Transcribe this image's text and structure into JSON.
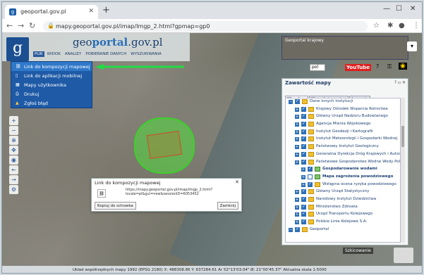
{
  "browser": {
    "tab_title": "geoportal.gov.pl",
    "url": "mapy.geoportal.gov.pl/imap/Imgp_2.html?gpmap=gp0"
  },
  "header": {
    "brand_prefix": "geo",
    "brand_main": "portal",
    "brand_suffix": ".gov.pl",
    "menu": [
      "PLIK",
      "WIDOK",
      "ANALIZY",
      "POBIERANIE DANYCH",
      "WYSZUKIWANIA"
    ],
    "active_menu": "PLIK"
  },
  "dropdown": {
    "items": [
      {
        "label": "Link do kompozycji mapowej",
        "icon": "link-icon"
      },
      {
        "label": "Link do aplikacji mobilnej",
        "icon": "mobile-icon"
      },
      {
        "label": "Mapy użytkownika",
        "icon": "map-icon"
      },
      {
        "label": "Drukuj",
        "icon": "print-icon"
      },
      {
        "label": "Zgłoś błąd",
        "icon": "warning-icon"
      }
    ]
  },
  "popup": {
    "title": "Link do kompozycji mapowej",
    "link": "https://mapy.geoportal.gov.pl/imap/Imgp_2.html?locale=pl&gui=new&sessionID=6053452",
    "copy_label": "Kopiuj do schowka",
    "close_label": "Zamknij"
  },
  "minimap": {
    "label": "Geoportal krajowy"
  },
  "toolbar": {
    "lang": "pol",
    "youtube": "YouTube"
  },
  "panel": {
    "title": "Zawartość mapy",
    "tabs": [
      "Warstwy",
      "Wyszukaj warstwę",
      "Legenda"
    ],
    "active_tab": "Warstwy",
    "tree": [
      {
        "label": "Dane innych instytucji",
        "level": 0,
        "checked": true,
        "folder": true
      },
      {
        "label": "Krajowy Ośrodek Wsparcia Rolnictwa",
        "level": 1,
        "checked": true,
        "folder": true
      },
      {
        "label": "Główny Urząd Nadzoru Budowlanego",
        "level": 1,
        "checked": true,
        "folder": true
      },
      {
        "label": "Agencja Mienia Wojskowego",
        "level": 1,
        "checked": true,
        "folder": true
      },
      {
        "label": "Instytut Geodezji i Kartografii",
        "level": 1,
        "checked": true,
        "folder": true
      },
      {
        "label": "Instytut Meteorologii i Gospodarki Wodnej",
        "level": 1,
        "checked": true,
        "folder": true
      },
      {
        "label": "Państwowy Instytut Geologiczny",
        "level": 1,
        "checked": true,
        "folder": true
      },
      {
        "label": "Generalna Dyrekcja Dróg Krajowych i Autostr",
        "level": 1,
        "checked": true,
        "folder": true
      },
      {
        "label": "Państwowe Gospodarstwo Wodne Wody Pol",
        "level": 1,
        "checked": true,
        "folder": true
      },
      {
        "label": "Gospodarowanie wodami",
        "level": 2,
        "checked": true,
        "folder": false,
        "bold": true
      },
      {
        "label": "Mapa zagrożenia powodziowego",
        "level": 2,
        "checked": false,
        "folder": false,
        "bold": true
      },
      {
        "label": "Wstępna ocena ryzyka powodziowego",
        "level": 2,
        "checked": true,
        "folder": true
      },
      {
        "label": "Główny Urząd Statystyczny",
        "level": 1,
        "checked": true,
        "folder": true
      },
      {
        "label": "Narodowy Instytut Dziedzictwa",
        "level": 1,
        "checked": true,
        "folder": true
      },
      {
        "label": "Ministerstwo Zdrowia",
        "level": 1,
        "checked": true,
        "folder": true
      },
      {
        "label": "Urząd Transportu Kolejowego",
        "level": 1,
        "checked": true,
        "folder": true
      },
      {
        "label": "Polskie Linie Kolejowe S.A.",
        "level": 1,
        "checked": true,
        "folder": true
      },
      {
        "label": "Geoportal",
        "level": 0,
        "checked": true,
        "folder": true
      }
    ]
  },
  "sketch_label": "Szkicowanie",
  "status": "Układ współrzędnych mapy 1992 (EPSG 2180)   X: 488308.86 Y: 637284.61   Ar 52°13'03.04\" Ø: 21°00'45.37\"   Aktualna skala 1:5000"
}
